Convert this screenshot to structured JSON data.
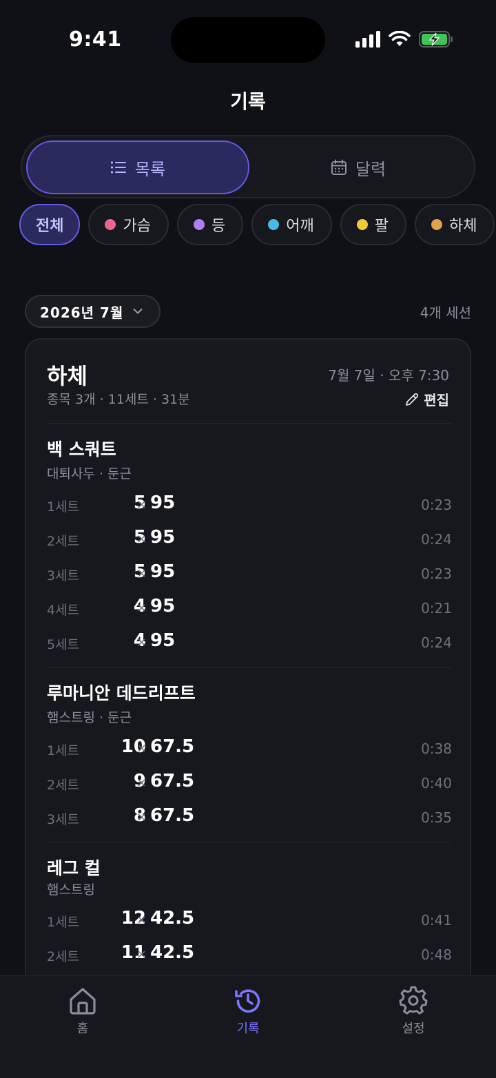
{
  "status": {
    "time": "9:41"
  },
  "header": {
    "title": "기록"
  },
  "view_toggle": {
    "list_label": "목록",
    "calendar_label": "달력",
    "selected": "목록"
  },
  "filters": [
    {
      "label": "전체",
      "active": true,
      "color": ""
    },
    {
      "label": "가슴",
      "active": false,
      "color": "#e9678d"
    },
    {
      "label": "등",
      "active": false,
      "color": "#b07ef5"
    },
    {
      "label": "어깨",
      "active": false,
      "color": "#4ab9ea"
    },
    {
      "label": "팔",
      "active": false,
      "color": "#f0c93b"
    },
    {
      "label": "하체",
      "active": false,
      "color": "#e0a24a"
    }
  ],
  "month": {
    "label": "2026년 7월",
    "session_count": "4개 세션"
  },
  "session": {
    "title": "하체",
    "meta": "종목 3개 · 11세트 · 31분",
    "datetime": "7월 7일 · 오후 7:30",
    "edit_label": "편집",
    "exercises": [
      {
        "name": "백 스쿼트",
        "sub": "대퇴사두 · 둔근",
        "sets": [
          {
            "label": "1세트",
            "reps": "5",
            "weight": "95",
            "time": "0:23"
          },
          {
            "label": "2세트",
            "reps": "5",
            "weight": "95",
            "time": "0:24"
          },
          {
            "label": "3세트",
            "reps": "5",
            "weight": "95",
            "time": "0:23"
          },
          {
            "label": "4세트",
            "reps": "4",
            "weight": "95",
            "time": "0:21"
          },
          {
            "label": "5세트",
            "reps": "4",
            "weight": "95",
            "time": "0:24"
          }
        ]
      },
      {
        "name": "루마니안 데드리프트",
        "sub": "햄스트링 · 둔근",
        "sets": [
          {
            "label": "1세트",
            "reps": "10",
            "weight": "67.5",
            "time": "0:38"
          },
          {
            "label": "2세트",
            "reps": "9",
            "weight": "67.5",
            "time": "0:40"
          },
          {
            "label": "3세트",
            "reps": "8",
            "weight": "67.5",
            "time": "0:35"
          }
        ]
      },
      {
        "name": "레그 컬",
        "sub": "햄스트링",
        "sets": [
          {
            "label": "1세트",
            "reps": "12",
            "weight": "42.5",
            "time": "0:41"
          },
          {
            "label": "2세트",
            "reps": "11",
            "weight": "42.5",
            "time": "0:48"
          }
        ]
      }
    ],
    "times_sign": "×"
  },
  "tabbar": {
    "home_label": "홈",
    "history_label": "기록",
    "settings_label": "설정",
    "active": "기록",
    "accent": "#7e74ff"
  }
}
